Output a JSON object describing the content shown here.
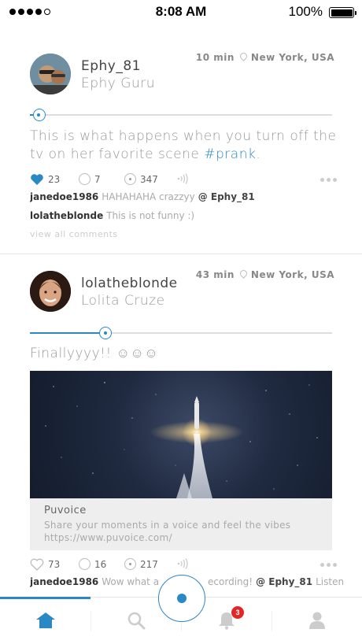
{
  "status_bar": {
    "time": "8:08 AM",
    "battery": "100%"
  },
  "posts": [
    {
      "username": "Ephy_81",
      "real_name": "Ephy Guru",
      "time_ago": "10 min",
      "location": "New York, USA",
      "progress": 0.03,
      "caption_text": "This is what happens when you turn off the tv on her favorite scene",
      "hashtag": "#prank",
      "caption_end": ".",
      "likes": "23",
      "liked": true,
      "comments_count": "7",
      "plays": "347",
      "comments": [
        {
          "user": "janedoe1986",
          "text": "HAHAHAHA crazzyy",
          "mention": "@ Ephy_81"
        },
        {
          "user": "lolatheblonde",
          "text": "This is not funny :)",
          "mention": ""
        }
      ],
      "view_all": "view all comments"
    },
    {
      "username": "lolatheblonde",
      "real_name": "Lolita Cruze",
      "time_ago": "43 min",
      "location": "New York, USA",
      "progress": 0.25,
      "caption_text": "Finallyyyy!! ☺☺☺",
      "link_card": {
        "title": "Puvoice",
        "description": "Share your moments in a voice and feel the vibes",
        "url": "https://www.puvoice.com/"
      },
      "likes": "73",
      "liked": false,
      "comments_count": "16",
      "plays": "217",
      "comments": [
        {
          "user": "janedoe1986",
          "text": "Wow what a",
          "text2": "ecording!",
          "mention": "@ Ephy_81",
          "tail": "Listen!"
        }
      ]
    }
  ],
  "tab_bar": {
    "items": [
      "home-icon",
      "search-icon",
      "bell-icon",
      "profile-icon"
    ],
    "notifications_badge": "3",
    "active_index": 0
  },
  "colors": {
    "accent": "#2a88c4",
    "badge": "#e02626"
  }
}
